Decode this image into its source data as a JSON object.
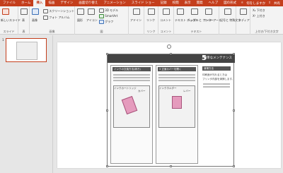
{
  "tabs": [
    "ファイル",
    "ホーム",
    "挿入",
    "描画",
    "デザイン",
    "画面切り替え",
    "アニメーション",
    "スライド ショー",
    "記録",
    "校閲",
    "表示",
    "開発",
    "ヘルプ",
    "図の形式"
  ],
  "active_tab": "挿入",
  "tell_me": "何をしますか",
  "share_label": "共有",
  "ribbon": {
    "new_slide": "新しいスライド",
    "slide_group": "スライド",
    "table": "表",
    "table_group": "表",
    "images": "画像",
    "screenshot": "スクリーンショット",
    "photo_album": "フォト アルバム",
    "images_group": "画像",
    "shapes": "図形",
    "icons": "アイコン",
    "models_3d": "3D モデル",
    "smartart": "SmartArt",
    "chart": "グラフ",
    "illustrations_group": "図",
    "addins": "アドイン",
    "link": "リンク",
    "links_group": "リンク",
    "comment": "コメント",
    "comments_group": "コメント",
    "textbox": "テキスト ボックス",
    "header_footer": "ヘッダーと フッター",
    "wordart": "ワード アート",
    "text_group": "テキスト",
    "symbols": "記号と 特殊文字",
    "media": "メディア",
    "subscript": "下付き",
    "superscript": "上付き",
    "subsup_group": "上付き/下付き文字"
  },
  "slide_number": "1",
  "document": {
    "step_number": "5",
    "title": "簡単なメンテナンス",
    "left_header": "インクの交換方法(続き)",
    "middle_header": "3  正面カバーを開く",
    "right_header": "清掃方法",
    "right_text_1": "印刷面が汚れるときは",
    "right_text_2": "プリンタ内部を清掃します。",
    "labels": {
      "ink_cartridge": "インクカートリッジ",
      "cover": "カバー",
      "ink_holder": "インクホルダー",
      "lever": "レバー"
    }
  }
}
